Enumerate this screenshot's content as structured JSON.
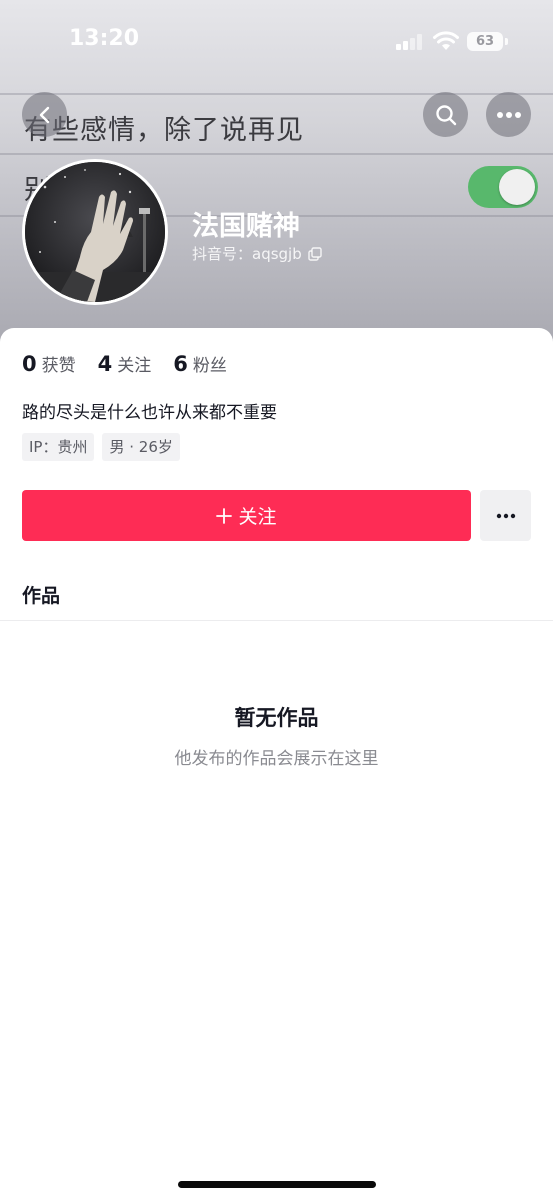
{
  "status_bar": {
    "time": "13:20",
    "battery": "63"
  },
  "background": {
    "line1": "有些感情，除了说再见",
    "line2": "别"
  },
  "nav": {
    "back_icon": "chevron-left-icon",
    "search_icon": "search-icon",
    "more_icon": "more-horizontal-icon"
  },
  "profile": {
    "nickname": "法国赌神",
    "douyin_id_label": "抖音号：aqsgjb",
    "copy_icon": "copy-icon"
  },
  "stats": [
    {
      "value": "0",
      "label": "获赞"
    },
    {
      "value": "4",
      "label": "关注"
    },
    {
      "value": "6",
      "label": "粉丝"
    }
  ],
  "signature": "路的尽头是什么也许从来都不重要",
  "tags": [
    "IP：贵州",
    "男 · 26岁"
  ],
  "actions": {
    "follow_label": "关注",
    "follow_icon": "plus-icon",
    "more_icon": "more-horizontal-icon"
  },
  "tabs": {
    "works_label": "作品"
  },
  "empty_state": {
    "title": "暂无作品",
    "subtitle": "他发布的作品会展示在这里"
  },
  "colors": {
    "accent": "#fe2c55",
    "toggle_on": "#58b86c",
    "text_primary": "#161823",
    "text_secondary": "#8a8b91"
  }
}
